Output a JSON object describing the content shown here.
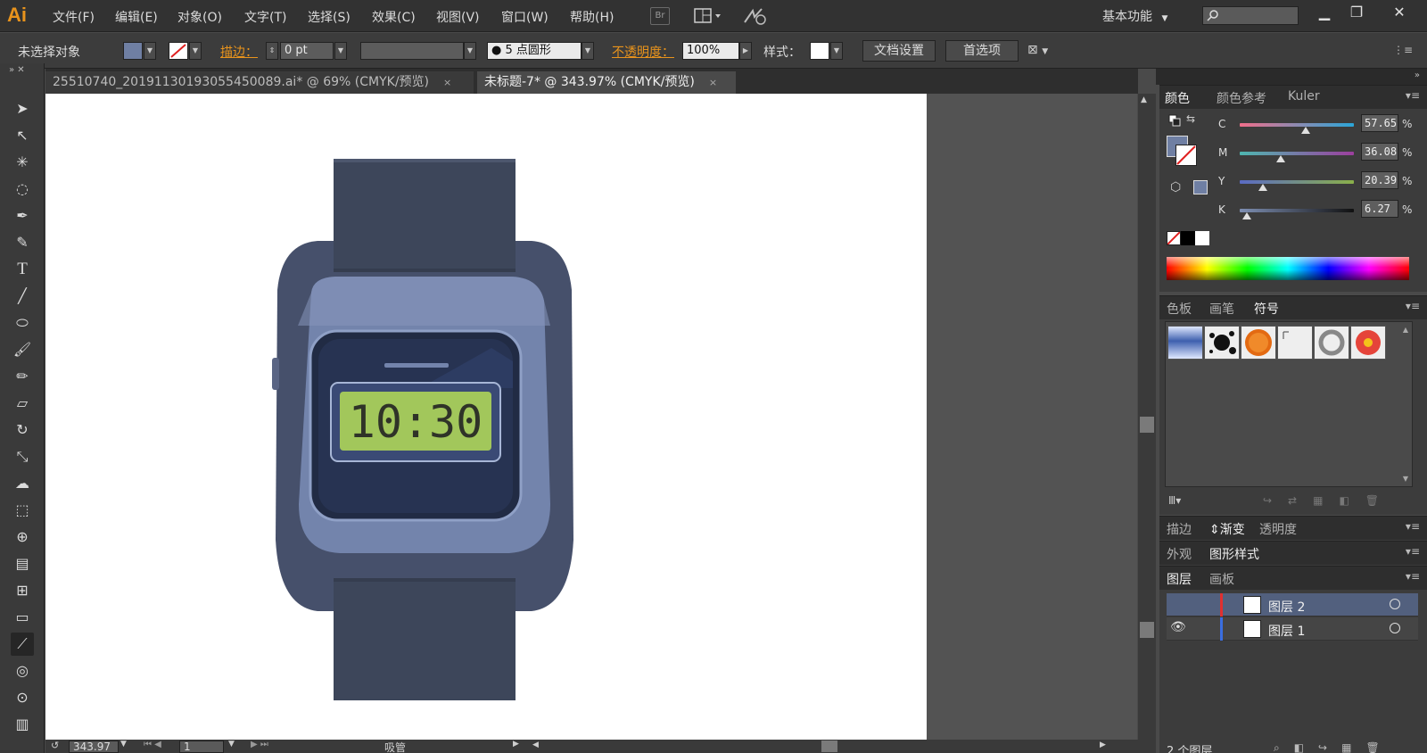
{
  "app": {
    "logo": "Ai"
  },
  "menu": [
    "文件(F)",
    "编辑(E)",
    "对象(O)",
    "文字(T)",
    "选择(S)",
    "效果(C)",
    "视图(V)",
    "窗口(W)",
    "帮助(H)"
  ],
  "menubar": {
    "bridge_label": "Br",
    "workspace": "基本功能"
  },
  "control_bar": {
    "selection_label": "未选择对象",
    "stroke_label": "描边：",
    "stroke_weight": "0 pt",
    "brush_profile": "5 点圆形",
    "opacity_label": "不透明度：",
    "opacity_value": "100%",
    "style_label": "样式：",
    "doc_setup": "文档设置",
    "preferences": "首选项"
  },
  "doc_tabs": [
    {
      "title": "25510740_20191130193055450089.ai* @ 69% (CMYK/预览)",
      "close": "×",
      "active": false
    },
    {
      "title": "未标题-7* @ 343.97% (CMYK/预览)",
      "close": "×",
      "active": true
    }
  ],
  "artwork": {
    "display_time": "10:30"
  },
  "color_panel": {
    "tabs": [
      "颜色",
      "颜色参考",
      "Kuler"
    ],
    "channels": [
      {
        "label": "C",
        "value": "57.65",
        "level": 0.5765
      },
      {
        "label": "M",
        "value": "36.08",
        "level": 0.3608
      },
      {
        "label": "Y",
        "value": "20.39",
        "level": 0.2039
      },
      {
        "label": "K",
        "value": "6.27",
        "level": 0.0627
      }
    ],
    "percent": "%"
  },
  "symbols_panel": {
    "tabs": [
      "色板",
      "画笔",
      "符号"
    ]
  },
  "stroke_panel": {
    "tabs": [
      "描边",
      "渐变",
      "透明度"
    ]
  },
  "appearance_panel": {
    "tabs": [
      "外观",
      "图形样式"
    ]
  },
  "layers_panel": {
    "tabs": [
      "图层",
      "画板"
    ],
    "layers": [
      {
        "name": "图层 2"
      },
      {
        "name": "图层 1"
      }
    ],
    "count": "2 个图层"
  },
  "status": {
    "zoom": "343.97",
    "artboard": "1",
    "tool": "吸管"
  },
  "colors": {
    "fill": "#6f7fa3",
    "accent": "#e8931c",
    "watch_body": "#46506b",
    "lcd": "#a2c75b"
  }
}
